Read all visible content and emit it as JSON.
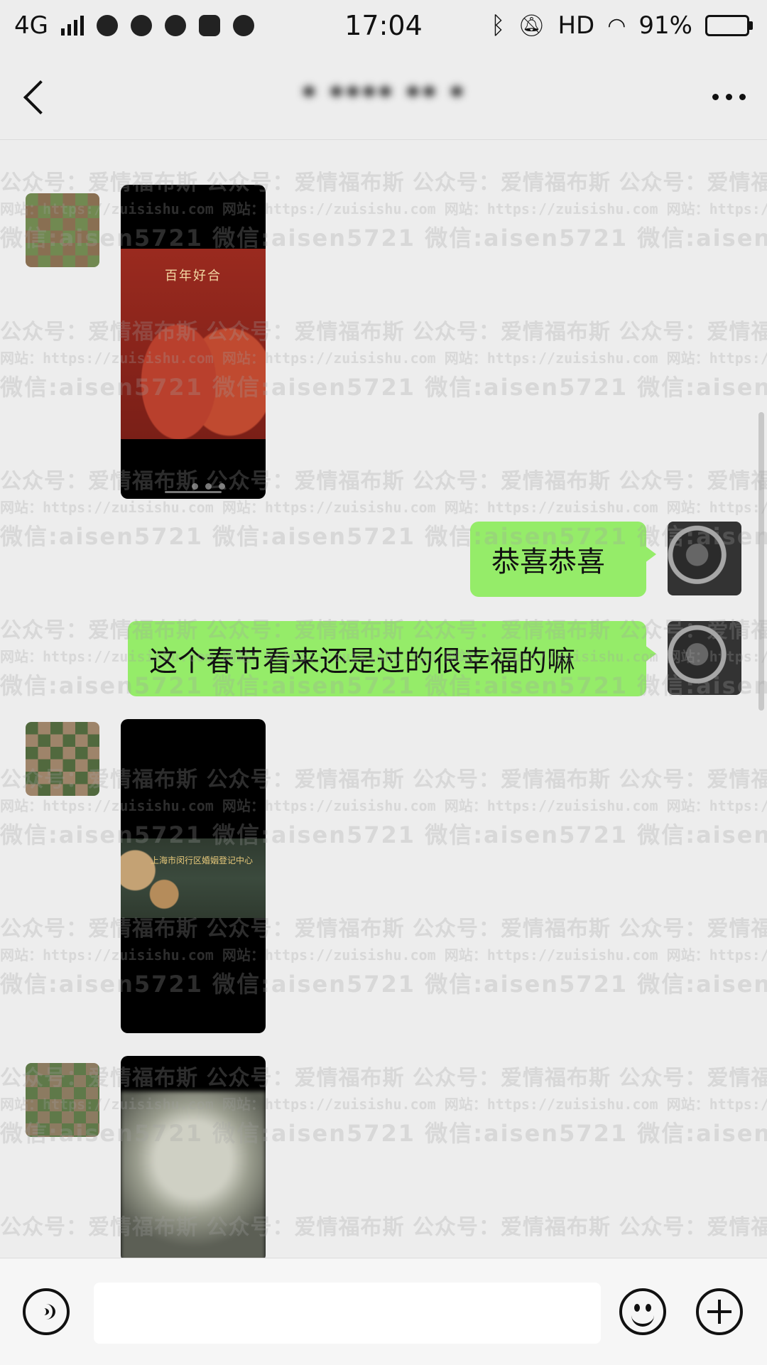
{
  "status_bar": {
    "network": "4G",
    "time": "17:04",
    "hd": "HD",
    "battery_percent": "91%",
    "battery_level": 0.91,
    "icons": [
      "clock-icon",
      "wechat-icon",
      "browser-icon",
      "media-icon",
      "app-icon",
      "bluetooth-icon",
      "mute-icon",
      "wifi-icon"
    ]
  },
  "nav": {
    "title": "* ****  **  *",
    "back_icon": "back-icon",
    "more_icon": "more-icon"
  },
  "watermark": {
    "line1": "公众号：爱情福布斯 公众号：爱情福布斯 公众号：爱情福布斯 公众号：爱情福布斯 公众号：爱情福布斯",
    "line2": "网站：https://zuisishu.com 网站：https://zuisishu.com 网站：https://zuisishu.com 网站：https://zuisishu.com 网站：https://zuisishu.com",
    "line3": "微信:aisen5721 微信:aisen5721 微信:aisen5721 微信:aisen5721 微信:aisen5721"
  },
  "messages": [
    {
      "side": "left",
      "type": "image",
      "poster_title": "百年好合"
    },
    {
      "side": "right",
      "type": "text",
      "text": "恭喜恭喜"
    },
    {
      "side": "right",
      "type": "text",
      "text": "这个春节看来还是过的很幸福的嘛"
    },
    {
      "side": "left",
      "type": "image",
      "strip_title": "上海市闵行区婚姻登记中心"
    },
    {
      "side": "left",
      "type": "image"
    }
  ],
  "input_bar": {
    "placeholder": "",
    "icons": [
      "voice-icon",
      "emoji-icon",
      "plus-icon"
    ]
  }
}
